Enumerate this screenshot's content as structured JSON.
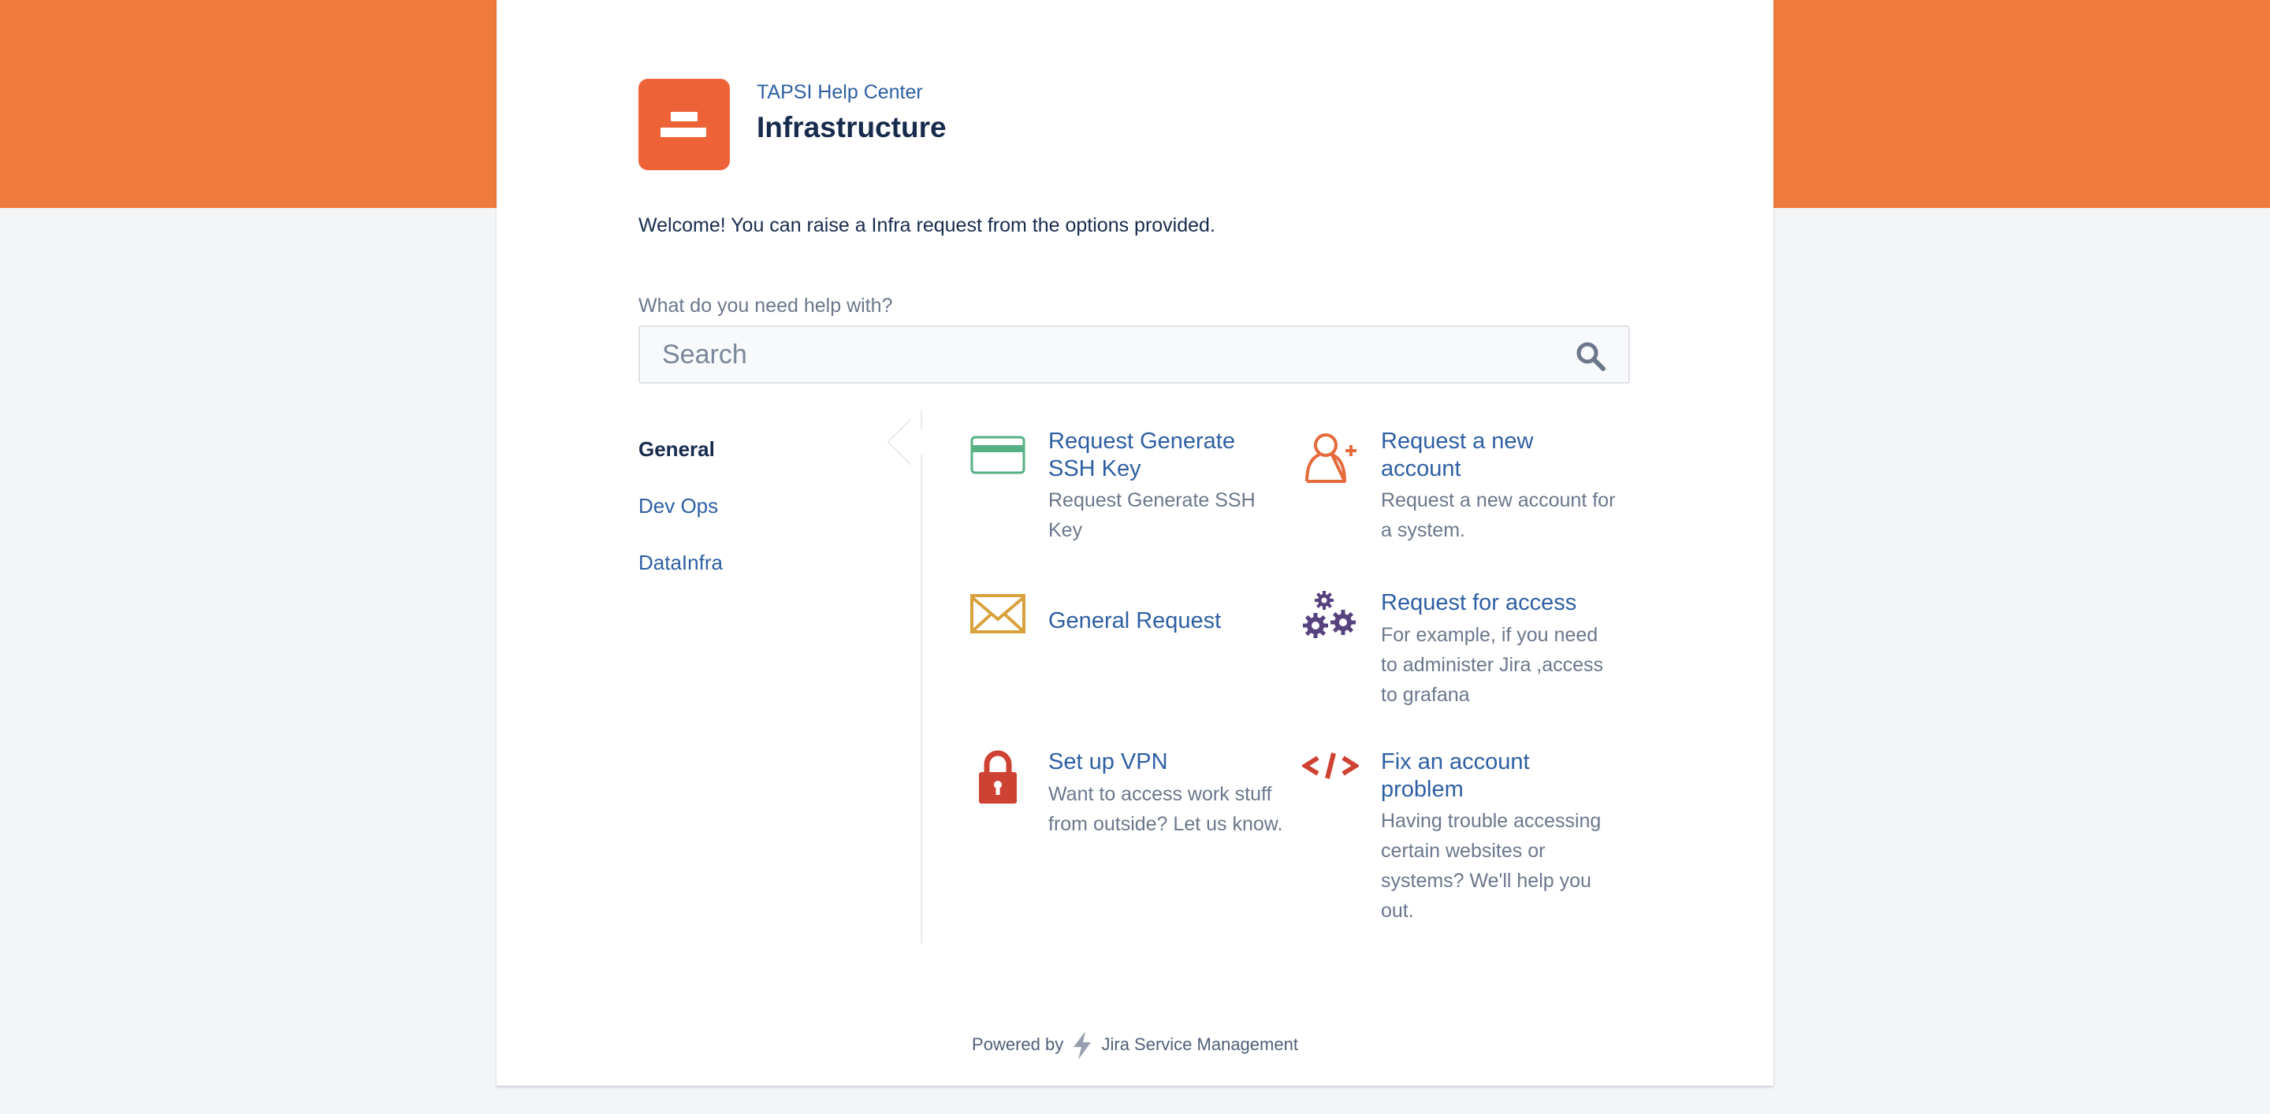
{
  "portal": {
    "help_center_link": "TAPSI Help Center",
    "title": "Infrastructure",
    "welcome": "Welcome! You can raise a Infra request from the options provided."
  },
  "search": {
    "label": "What do you need help with?",
    "placeholder": "Search"
  },
  "groups": [
    {
      "label": "General",
      "active": true
    },
    {
      "label": "Dev Ops",
      "active": false
    },
    {
      "label": "DataInfra",
      "active": false
    }
  ],
  "request_types": [
    {
      "name": "Request Generate SSH Key",
      "description": "Request Generate SSH Key",
      "icon": "credit-card-icon",
      "color": "#57b083"
    },
    {
      "name": "Request a new account",
      "description": "Request a new account for a system.",
      "icon": "add-user-icon",
      "color": "#e56a3c"
    },
    {
      "name": "General Request",
      "description": "",
      "icon": "envelope-icon",
      "color": "#d9a13b"
    },
    {
      "name": "Request for access",
      "description": "For example, if you need to administer Jira ,access to grafana",
      "icon": "gears-icon",
      "color": "#55427f"
    },
    {
      "name": "Set up VPN",
      "description": "Want to access work stuff from outside? Let us know.",
      "icon": "lock-icon",
      "color": "#cd4233"
    },
    {
      "name": "Fix an account problem",
      "description": "Having trouble accessing certain websites or systems? We'll help you out.",
      "icon": "code-icon",
      "color": "#cd4233"
    }
  ],
  "footer": {
    "prefix": "Powered by",
    "product": "Jira Service Management",
    "icon": "lightning-bolt-icon"
  },
  "colors": {
    "banner": "#ef7a3d",
    "logo": "#ee6238",
    "link": "#2e5fa3",
    "text": "#172b4d",
    "muted": "#6b778c"
  }
}
